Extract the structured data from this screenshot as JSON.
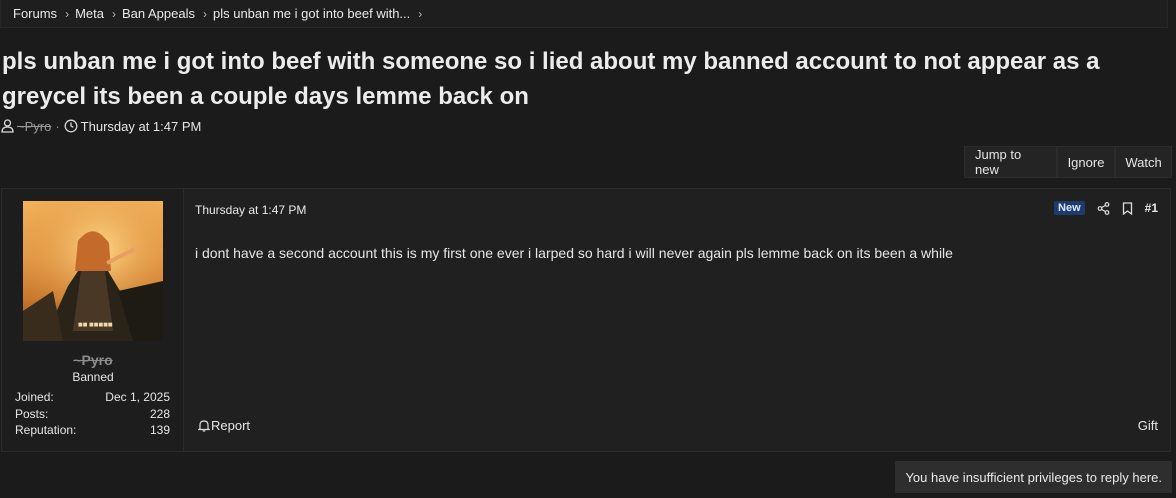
{
  "breadcrumb": {
    "items": [
      "Forums",
      "Meta",
      "Ban Appeals",
      "pls unban me i got into beef with..."
    ]
  },
  "thread": {
    "title": "pls unban me i got into beef with someone so i lied about my banned account to not appear as a greycel its been a couple days lemme back on",
    "author": "~Pyro",
    "separator": "·",
    "date": "Thursday at 1:47 PM"
  },
  "actions": {
    "jump_to_new": "Jump to new",
    "ignore": "Ignore",
    "watch": "Watch"
  },
  "post": {
    "user": {
      "name": "~Pyro",
      "title": "Banned",
      "avatar_icon": "anime-character-avatar",
      "stats": [
        {
          "label": "Joined:",
          "value": "Dec 1, 2025"
        },
        {
          "label": "Posts:",
          "value": "228"
        },
        {
          "label": "Reputation:",
          "value": "139"
        }
      ]
    },
    "date": "Thursday at 1:47 PM",
    "new_badge": "New",
    "number": "#1",
    "body": "i dont have a second account this is my first one ever i larped so hard i will never again pls lemme back on its been a while",
    "report_label": "Report",
    "gift_label": "Gift"
  },
  "reply_notice": "You have insufficient privileges to reply here.",
  "colors": {
    "background": "#1b1b1b",
    "panel": "#202020",
    "new_badge": "#1f3a6e"
  }
}
